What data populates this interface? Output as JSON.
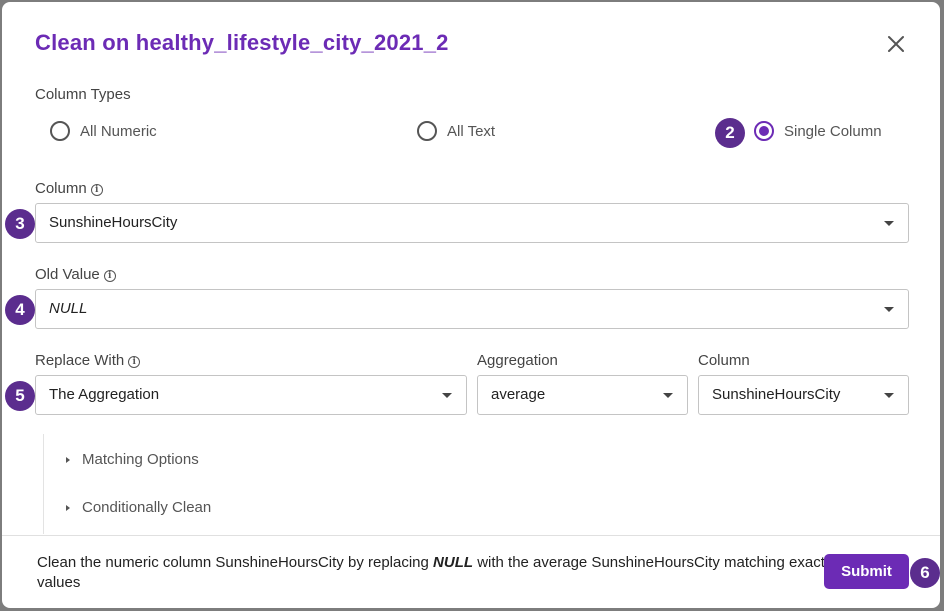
{
  "modal": {
    "title": "Clean on healthy_lifestyle_city_2021_2"
  },
  "column_types": {
    "label": "Column Types",
    "options": [
      "All Numeric",
      "All Text",
      "Single Column"
    ],
    "selected": "Single Column"
  },
  "column": {
    "label": "Column",
    "value": "SunshineHoursCity"
  },
  "old_value": {
    "label": "Old Value",
    "value": "NULL"
  },
  "replace_with": {
    "label": "Replace With",
    "value": "The Aggregation"
  },
  "aggregation": {
    "label": "Aggregation",
    "value": "average"
  },
  "agg_column": {
    "label": "Column",
    "value": "SunshineHoursCity"
  },
  "expanders": {
    "matching": "Matching Options",
    "conditional": "Conditionally Clean"
  },
  "footer": {
    "desc_part1": "Clean the numeric column SunshineHoursCity by replacing ",
    "desc_emph": "NULL",
    "desc_part2": " with the average SunshineHoursCity matching exact values",
    "submit_label": "Submit"
  },
  "badges": [
    "2",
    "3",
    "4",
    "5",
    "6"
  ],
  "colors": {
    "accent": "#6c2bb5",
    "badge": "#5b2d8e"
  }
}
